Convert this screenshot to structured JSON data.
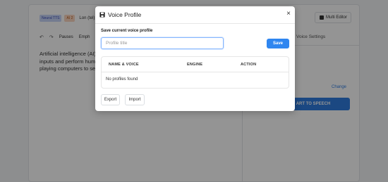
{
  "background": {
    "badges": [
      "Neural TTS",
      "AI 2",
      "Lon (tel) 1"
    ],
    "multi_editor_label": "Multi Editor",
    "toolbar": {
      "undo_icon": "undo-icon",
      "redo_icon": "redo-icon",
      "items": [
        "Pauses",
        "Emph"
      ]
    },
    "editor_lines": [
      "Artificial intelligence (AI) m",
      "inputs and perform human-",
      "playing computers to self-d"
    ],
    "voice_settings_label": "Voice Settings",
    "change_link": "Change",
    "start_button_label": "ART TO SPEECH"
  },
  "modal": {
    "title": "Voice Profile",
    "title_icon": "save-icon",
    "close_icon": "close-icon",
    "section_label": "Save current voice profile",
    "input": {
      "placeholder": "Profile title",
      "value": ""
    },
    "save_label": "Save",
    "table": {
      "columns": [
        "NAME & VOICE",
        "ENGINE",
        "ACTION"
      ],
      "empty_text": "No profiles found"
    },
    "export_label": "Export",
    "import_label": "Import"
  },
  "colors": {
    "accent": "#2f86f0",
    "overlay": "rgba(0,0,0,0.42)"
  }
}
